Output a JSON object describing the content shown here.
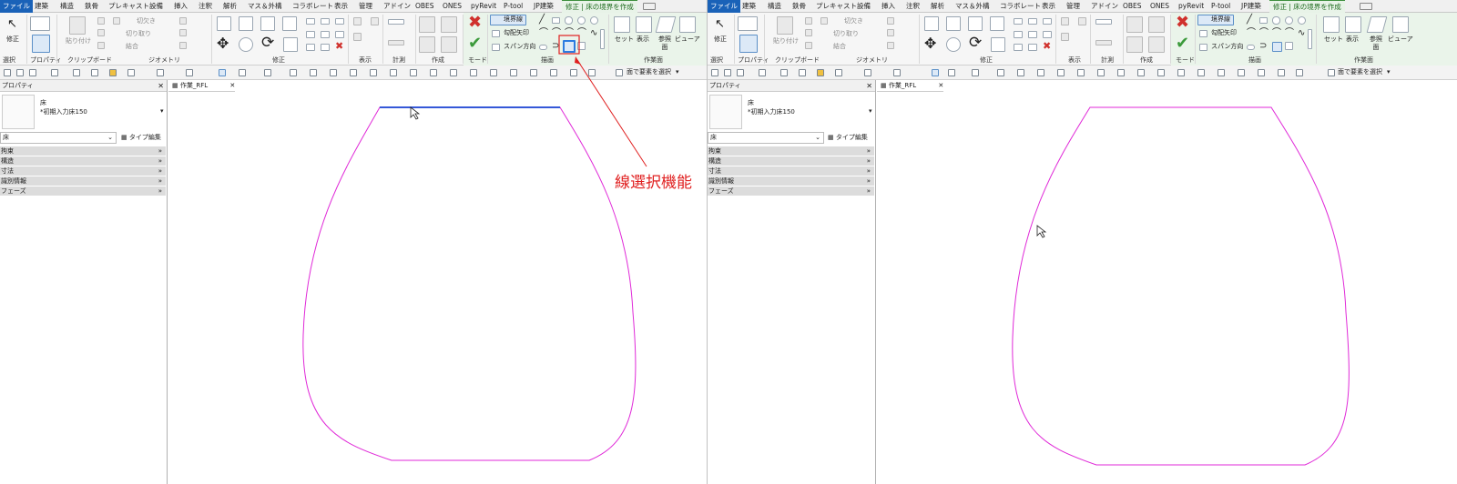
{
  "colors": {
    "outline": "#e02ad8",
    "selected_edge": "#3558d8",
    "callout": "#e02020",
    "file_tab": "#1a62b8",
    "context_tab": "#3f8f3f"
  },
  "tabs": [
    "ファイル",
    "建築",
    "構造",
    "鉄骨",
    "プレキャスト",
    "設備",
    "挿入",
    "注釈",
    "解析",
    "マス＆外構",
    "コラボレート",
    "表示",
    "管理",
    "アドイン",
    "OBES",
    "ONES",
    "pyRevit",
    "P-tool",
    "JP建築",
    "修正 | 床の境界を作成"
  ],
  "ribbon": {
    "modify_label": "修正",
    "paste_label": "貼り付け",
    "cut_label": "切り取り",
    "cope_label": "切欠き",
    "join_label": "結合",
    "boundary_line_label": "境界線",
    "slope_arrow_label": "勾配矢印",
    "span_direction_label": "スパン方向",
    "set_label": "セット",
    "show_label": "表示",
    "ref_plane_label": "参照面",
    "viewer_label": "ビューア",
    "groups": [
      "選択",
      "プロパティ",
      "クリップボード",
      "ジオメトリ",
      "修正",
      "表示",
      "計測",
      "作成",
      "モード",
      "描画",
      "作業面"
    ]
  },
  "qat": {
    "select_by_face": "面で要素を選択"
  },
  "properties": {
    "title": "プロパティ",
    "family": "床",
    "type_name": "*初期入力床150",
    "dropdown_value": "床",
    "type_edit": "タイプ編集",
    "categories": [
      "拘束",
      "構造",
      "寸法",
      "識別情報",
      "フェーズ"
    ]
  },
  "view": {
    "tab_label": "作業_RFL"
  },
  "annotation": {
    "text": "線選択機能"
  }
}
